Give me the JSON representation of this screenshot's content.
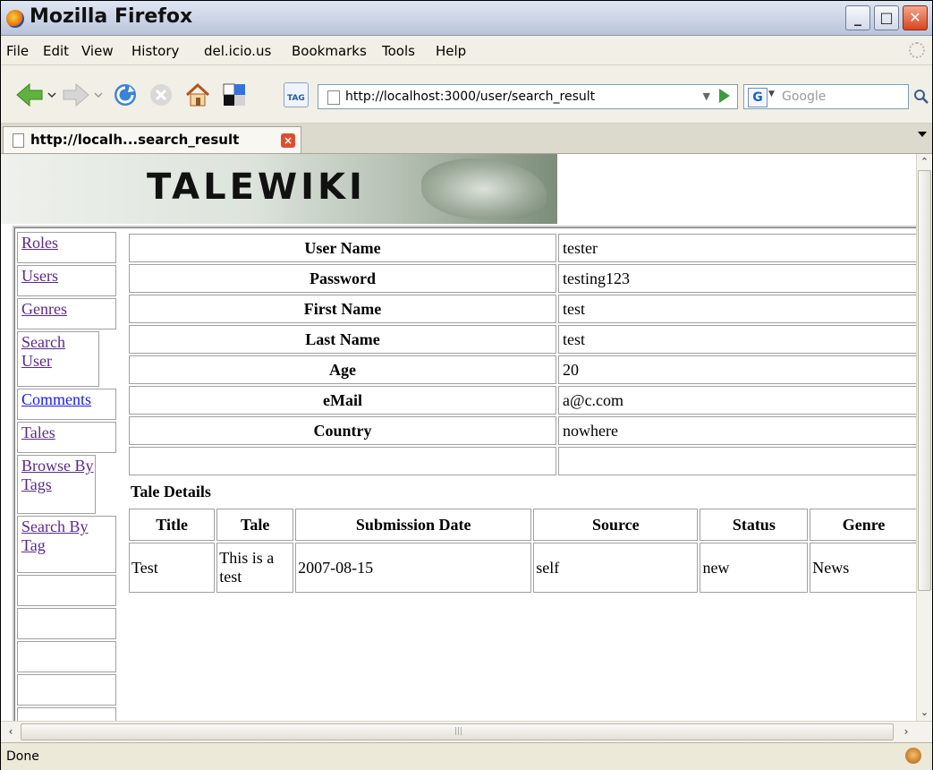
{
  "window": {
    "title": "Mozilla Firefox"
  },
  "menu": [
    "File",
    "Edit",
    "View",
    "History",
    "del.icio.us",
    "Bookmarks",
    "Tools",
    "Help"
  ],
  "nav": {
    "url": "http://localhost:3000/user/search_result",
    "search_placeholder": "Google",
    "search_engine_letter": "G",
    "tag_label": "TAG"
  },
  "tab": {
    "label": "http://localh...search_result"
  },
  "status": {
    "text": "Done"
  },
  "page": {
    "banner": "TALEWIKI",
    "sidebar": [
      {
        "label": "Roles",
        "color": "#5a2a8a"
      },
      {
        "label": "Users",
        "color": "#5a2a8a"
      },
      {
        "label": "Genres",
        "color": "#5a2a8a"
      },
      {
        "label": "Search User",
        "color": "#5a2a8a"
      },
      {
        "label": "Comments",
        "color": "#1a1aee"
      },
      {
        "label": "Tales",
        "color": "#5a2a8a"
      },
      {
        "label": "Browse By Tags",
        "color": "#5a2a8a"
      },
      {
        "label": "Search By Tag",
        "color": "#5a2a8a"
      }
    ],
    "user_fields": [
      {
        "label": "User Name",
        "value": "tester"
      },
      {
        "label": "Password",
        "value": "testing123"
      },
      {
        "label": "First Name",
        "value": "test"
      },
      {
        "label": "Last Name",
        "value": "test"
      },
      {
        "label": "Age",
        "value": "20"
      },
      {
        "label": "eMail",
        "value": "a@c.com"
      },
      {
        "label": "Country",
        "value": "nowhere"
      },
      {
        "label": "",
        "value": ""
      }
    ],
    "tale_section_title": "Tale Details",
    "tale_columns": [
      "Title",
      "Tale",
      "Submission Date",
      "Source",
      "Status",
      "Genre"
    ],
    "tale_rows": [
      [
        "Test",
        "This is a test",
        "2007-08-15",
        "self",
        "new",
        "News"
      ]
    ]
  }
}
